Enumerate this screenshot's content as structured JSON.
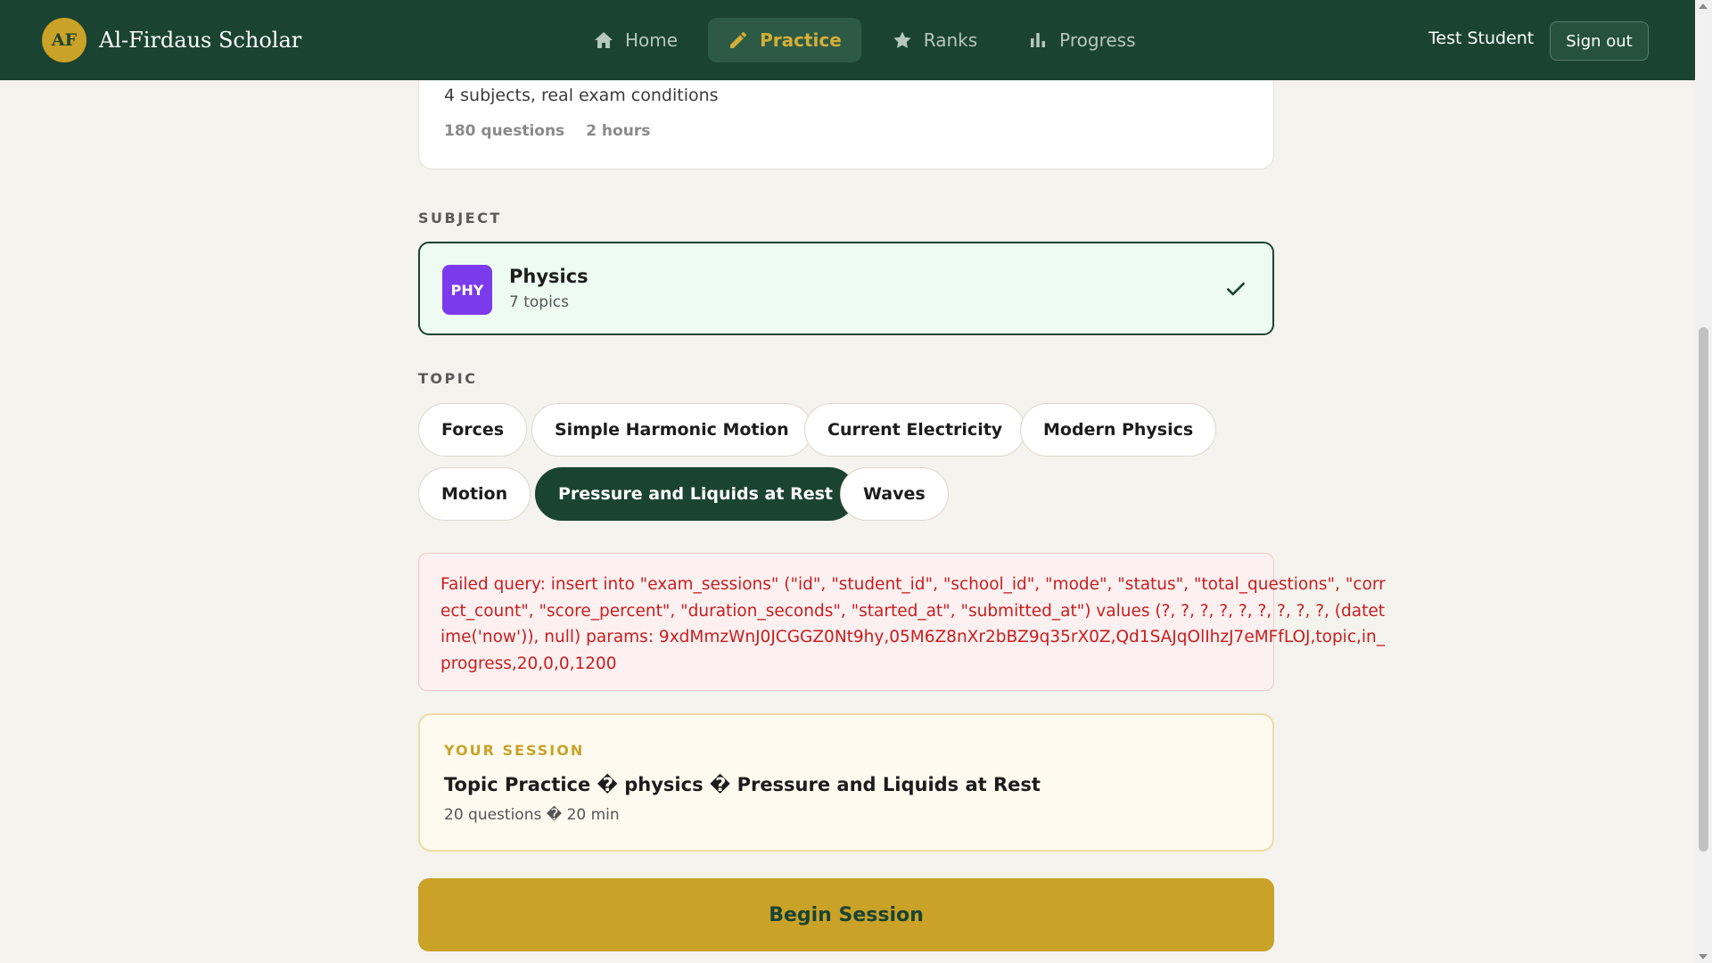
{
  "header": {
    "logo_text": "AF",
    "brand_name": "Al-Firdaus Scholar",
    "nav": [
      {
        "label": "Home",
        "icon": "home-icon"
      },
      {
        "label": "Practice",
        "icon": "pencil-icon",
        "active": true
      },
      {
        "label": "Ranks",
        "icon": "star-icon"
      },
      {
        "label": "Progress",
        "icon": "bar-chart-icon"
      }
    ],
    "user_name": "Test Student",
    "signout_label": "Sign out"
  },
  "exam_card": {
    "description": "4 subjects, real exam conditions",
    "questions": "180 questions",
    "duration": "2 hours"
  },
  "subject_section": {
    "label": "SUBJECT",
    "badge": "PHY",
    "name": "Physics",
    "topics_count": "7 topics"
  },
  "topic_section": {
    "label": "TOPIC",
    "topics": [
      "Forces",
      "Simple Harmonic Motion",
      "Current Electricity",
      "Modern Physics",
      "Motion",
      "Pressure and Liquids at Rest",
      "Waves"
    ],
    "selected": "Pressure and Liquids at Rest"
  },
  "error": {
    "message": "Failed query: insert into \"exam_sessions\" (\"id\", \"student_id\", \"school_id\", \"mode\", \"status\", \"total_questions\", \"correct_count\", \"score_percent\", \"duration_seconds\", \"started_at\", \"submitted_at\") values (?, ?, ?, ?, ?, ?, ?, ?, ?, (datetime('now')), null) params: 9xdMmzWnJ0JCGGZ0Nt9hy,05M6Z8nXr2bBZ9q35rX0Z,Qd1SAJqOlIhzJ7eMFfLOJ,topic,in_progress,20,0,0,1200"
  },
  "session": {
    "label": "YOUR SESSION",
    "title": "Topic Practice � physics � Pressure and Liquids at Rest",
    "subtitle": "20 questions � 20 min"
  },
  "begin_label": "Begin Session",
  "colors": {
    "header_bg": "#1b4332",
    "accent_gold": "#c9a227",
    "subject_badge": "#7c3aed",
    "error_red": "#c81e1e",
    "page_bg": "#f5f3ee"
  }
}
